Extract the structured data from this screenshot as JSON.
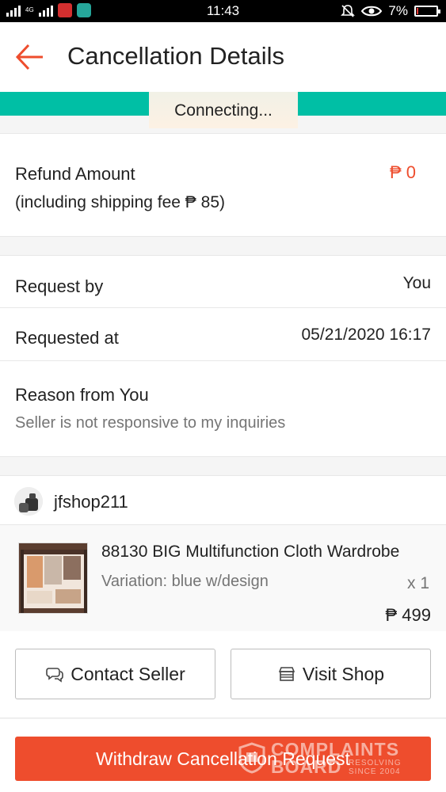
{
  "status_bar": {
    "network_label": "4G",
    "time": "11:43",
    "battery": "7%",
    "battery_level": 0.07
  },
  "header": {
    "title": "Cancellation Details"
  },
  "toast": {
    "text": "Connecting..."
  },
  "refund": {
    "label": "Refund Amount",
    "amount": "₱ 0",
    "shipping_note": "(including shipping fee  ₱ 85)"
  },
  "request": {
    "by_label": "Request by",
    "by_value": "You",
    "at_label": "Requested at",
    "at_value": "05/21/2020 16:17",
    "reason_label": "Reason from You",
    "reason_text": "Seller is not responsive to my inquiries"
  },
  "shop": {
    "name": "jfshop211"
  },
  "product": {
    "name": "88130 BIG Multifunction Cloth Wardrobe",
    "variation": "Variation: blue w/design",
    "quantity": "x 1",
    "price": "₱ 499"
  },
  "actions": {
    "contact_seller": "Contact Seller",
    "visit_shop": "Visit Shop",
    "withdraw": "Withdraw Cancellation Request"
  },
  "watermark": {
    "title": "COMPLAINTS",
    "sub": "BOARD",
    "tag_1": "RESOLVING",
    "tag_2": "SINCE 2004"
  },
  "colors": {
    "accent": "#ee4d2d",
    "teal": "#00bfa5"
  }
}
